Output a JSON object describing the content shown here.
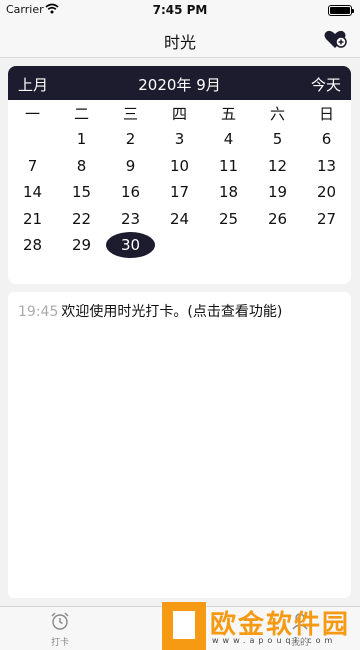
{
  "status_bar": {
    "carrier": "Carrier",
    "time": "7:45 PM"
  },
  "nav": {
    "title": "时光",
    "right_icon": "heart-badge-icon"
  },
  "calendar": {
    "prev_label": "上月",
    "month_label": "2020年 9月",
    "today_label": "今天",
    "weekdays": [
      "一",
      "二",
      "三",
      "四",
      "五",
      "六",
      "日"
    ],
    "weeks": [
      [
        "",
        "1",
        "2",
        "3",
        "4",
        "5",
        "6"
      ],
      [
        "7",
        "8",
        "9",
        "10",
        "11",
        "12",
        "13"
      ],
      [
        "14",
        "15",
        "16",
        "17",
        "18",
        "19",
        "20"
      ],
      [
        "21",
        "22",
        "23",
        "24",
        "25",
        "26",
        "27"
      ],
      [
        "28",
        "29",
        "30",
        "",
        "",
        "",
        ""
      ]
    ],
    "selected_day": "30",
    "accent_color": "#1c1c2e"
  },
  "entries": [
    {
      "time": "19:45",
      "text": "欢迎使用时光打卡。(点击查看功能)"
    }
  ],
  "tab_bar": {
    "tabs": [
      {
        "label": "打卡",
        "icon": "alarm-clock-icon"
      },
      {
        "label": "",
        "icon": "calendar-icon"
      },
      {
        "label": "我的",
        "icon": "person-icon"
      }
    ]
  },
  "watermark": {
    "text": "欧金软件园",
    "url": "www.apouqi.com",
    "color": "#f59a12"
  }
}
